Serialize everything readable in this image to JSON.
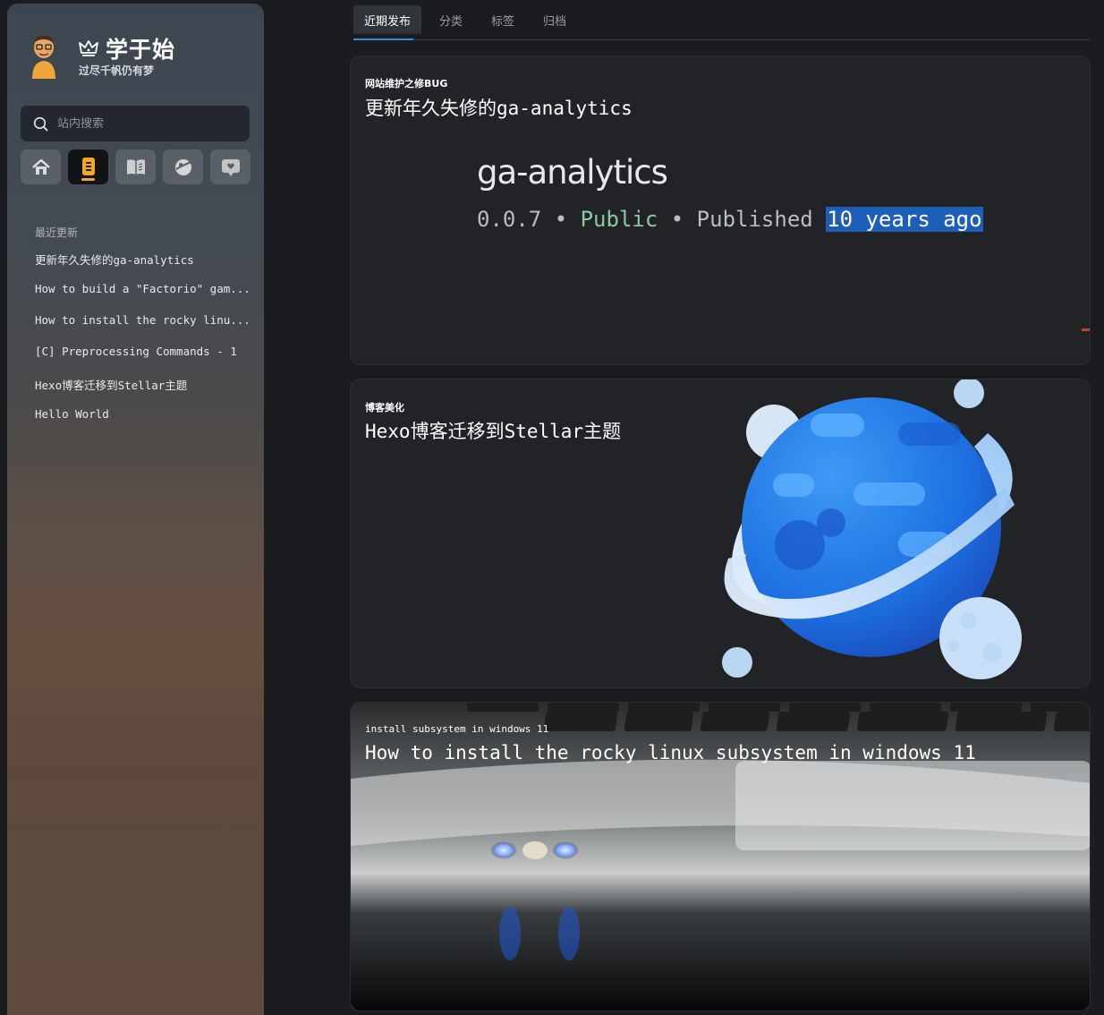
{
  "sidebar": {
    "site_title": "学于始",
    "site_subtitle": "过尽千帆仍有梦",
    "search_placeholder": "站内搜索",
    "nav_icons": [
      "home-icon",
      "notebook-icon",
      "book-icon",
      "planet-icon",
      "heart-chat-icon"
    ],
    "active_nav": "notebook-icon",
    "recent_heading": "最近更新",
    "recent_items": [
      "更新年久失修的ga-analytics",
      "How to build a \"Factorio\" gam...",
      "How to install the rocky linu...",
      "[C] Preprocessing Commands - 1",
      "Hexo博客迁移到Stellar主题",
      "Hello World"
    ]
  },
  "tabs": [
    "近期发布",
    "分类",
    "标签",
    "归档"
  ],
  "active_tab": "近期发布",
  "posts": [
    {
      "tag": "网站维护之修BUG",
      "title": "更新年久失修的ga-analytics",
      "cover": {
        "package_name": "ga-analytics",
        "version": "0.0.7",
        "visibility": "Public",
        "published_label": "Published",
        "published_when": "10 years ago",
        "separator": "•"
      }
    },
    {
      "tag": "博客美化",
      "title": "Hexo博客迁移到Stellar主题"
    },
    {
      "tag": "install subsystem in windows 11",
      "title": "How to install the rocky linux subsystem in windows 11"
    }
  ],
  "colors": {
    "accent": "#2e8fd6",
    "active_nav_icon": "#f5a623",
    "card_bg": "#222327",
    "page_bg": "#1b1c1f"
  }
}
